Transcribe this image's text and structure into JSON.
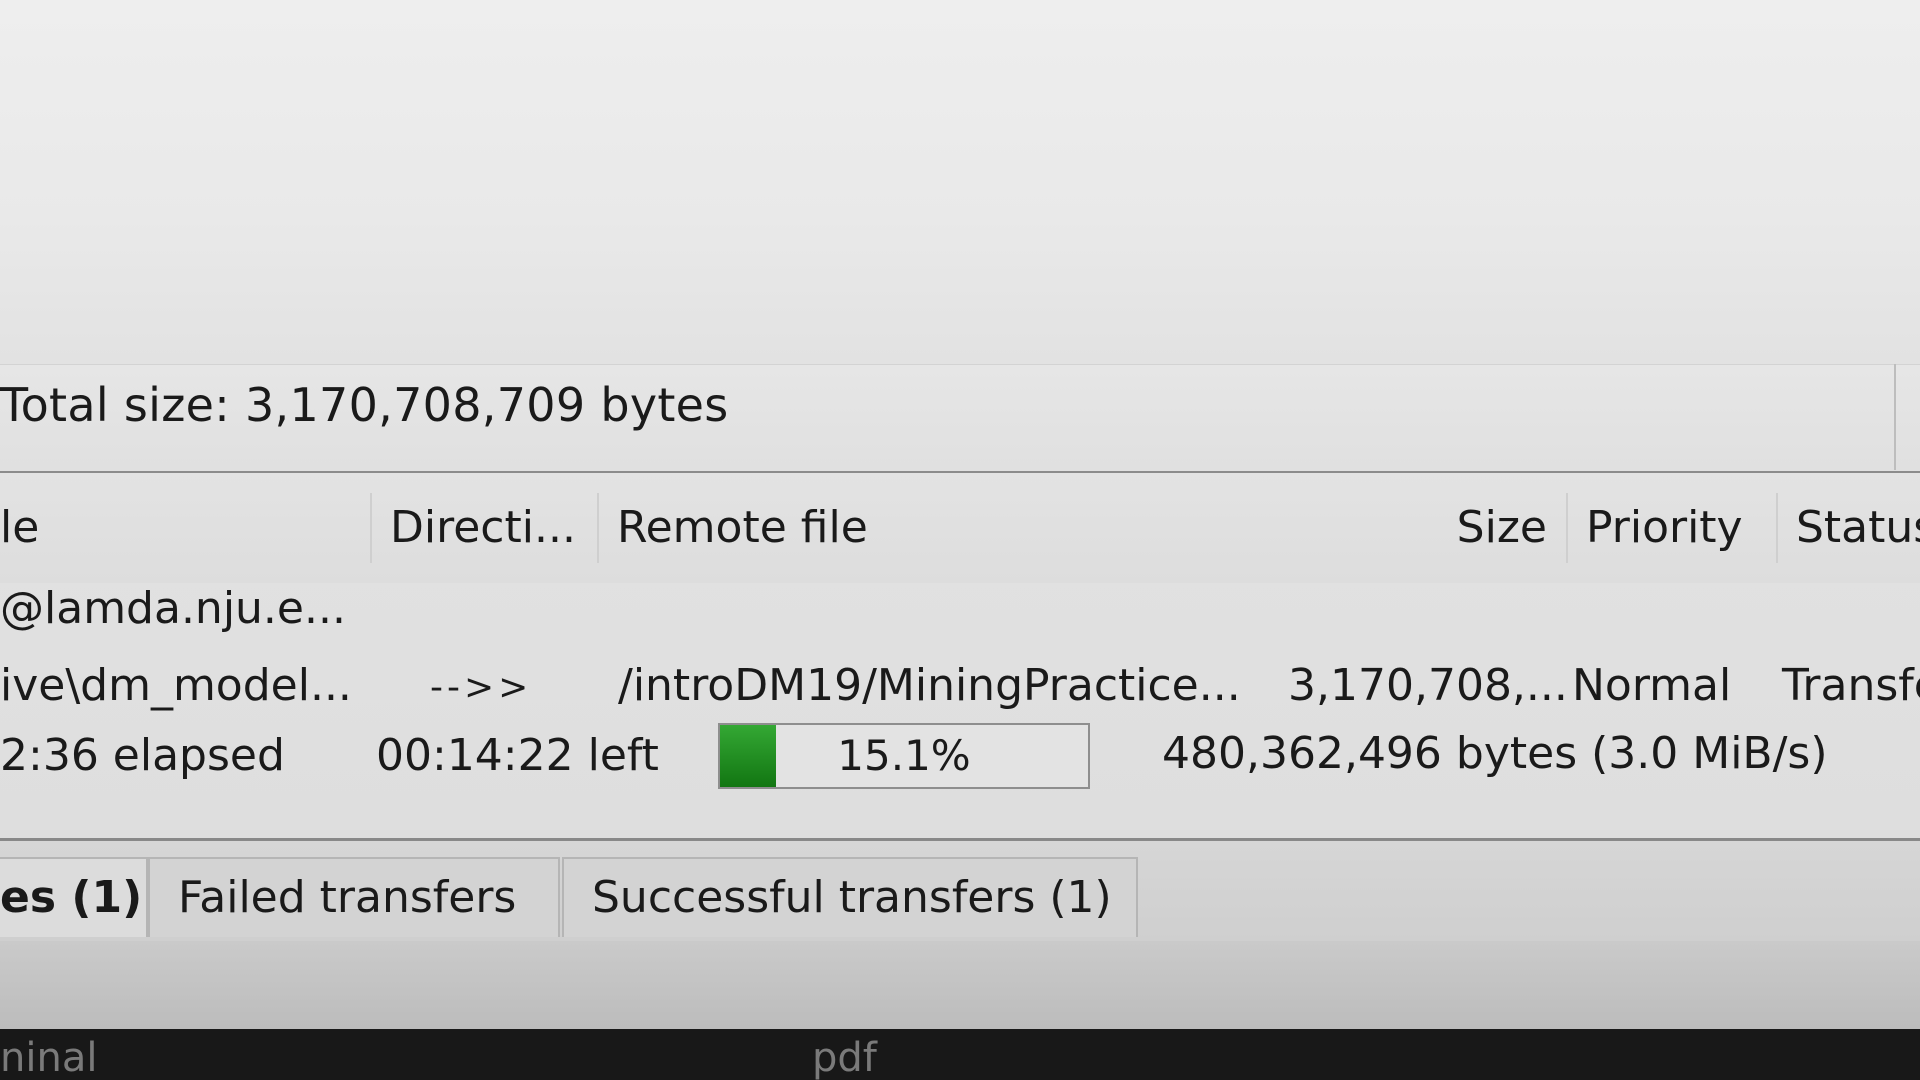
{
  "status": {
    "total_size": "Total size: 3,170,708,709 bytes"
  },
  "queue": {
    "columns": [
      {
        "id": "local-file",
        "label": "le"
      },
      {
        "id": "direction",
        "label": "Directi..."
      },
      {
        "id": "remote-file",
        "label": "Remote file"
      },
      {
        "id": "size",
        "label": "Size"
      },
      {
        "id": "priority",
        "label": "Priority"
      },
      {
        "id": "status",
        "label": "Status"
      }
    ],
    "server_row": {
      "server": "@lamda.nju.e..."
    },
    "file_row": {
      "local": "ive\\dm_model...",
      "direction": "-->>",
      "remote": "/introDM19/MiningPractice...",
      "size": "3,170,708,...",
      "priority": "Normal",
      "status": "Transfe"
    },
    "progress_row": {
      "elapsed": "2:36 elapsed",
      "left": "00:14:22 left",
      "percent_label": "15.1%",
      "percent_value": 15.1,
      "bytes": "480,362,496 bytes (3.0 MiB/s)",
      "fill_color": "#1e8c1e"
    }
  },
  "tabs": [
    {
      "label": "es (1)",
      "active": true
    },
    {
      "label": "Failed transfers",
      "active": false
    },
    {
      "label": "Successful transfers (1)",
      "active": false
    }
  ],
  "taskbar": {
    "left_label": "ninal",
    "center_label": "pdf"
  }
}
